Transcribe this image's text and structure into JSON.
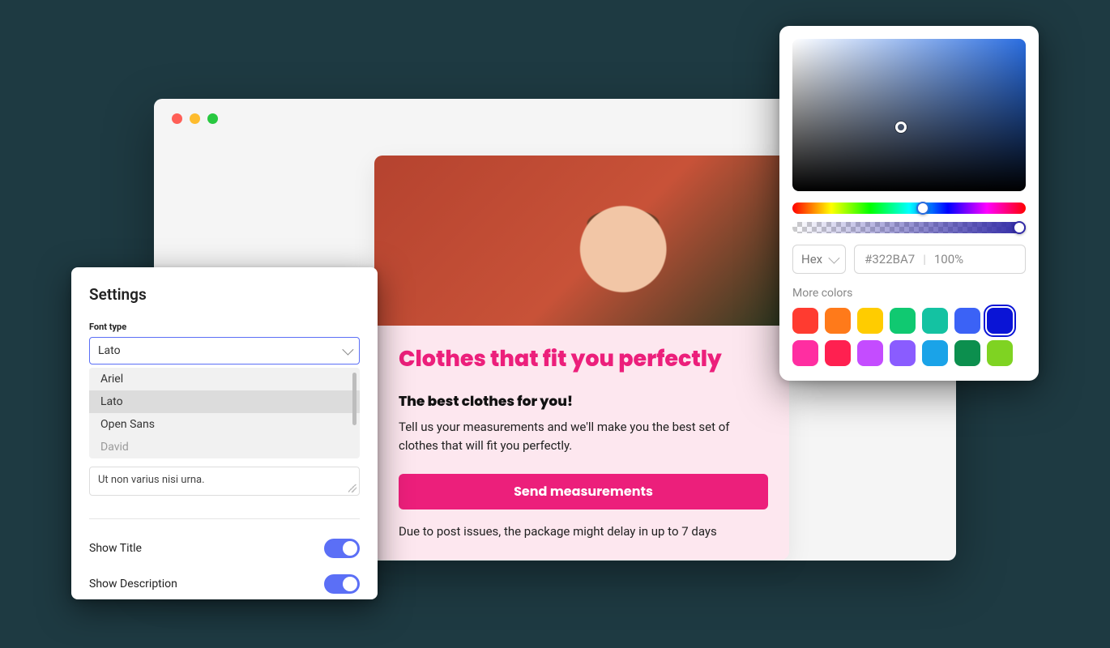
{
  "browser": {
    "card": {
      "title": "Clothes that fit you perfectly",
      "subtitle": "The best clothes for you!",
      "description": "Tell us your measurements and we'll make you the best set of clothes that will fit you perfectly.",
      "button_label": "Send measurements",
      "note": "Due to post issues, the package might delay in up to 7 days"
    }
  },
  "settings": {
    "title": "Settings",
    "font_type_label": "Font type",
    "font_selected": "Lato",
    "font_options": [
      "Ariel",
      "Lato",
      "Open Sans",
      "David"
    ],
    "text_sample": "Ut non varius nisi urna.",
    "show_title_label": "Show Title",
    "show_title_on": true,
    "show_description_label": "Show Description",
    "show_description_on": true
  },
  "picker": {
    "format": "Hex",
    "value": "#322BA7",
    "opacity": "100%",
    "more_colors_label": "More colors",
    "swatches": [
      {
        "color": "#ff3b30",
        "selected": false
      },
      {
        "color": "#ff7a1a",
        "selected": false
      },
      {
        "color": "#ffcc00",
        "selected": false
      },
      {
        "color": "#10c971",
        "selected": false
      },
      {
        "color": "#14c2a2",
        "selected": false
      },
      {
        "color": "#3b62f6",
        "selected": false
      },
      {
        "color": "#0a14d6",
        "selected": true
      },
      {
        "color": "#ff2ea1",
        "selected": false
      },
      {
        "color": "#ff2050",
        "selected": false
      },
      {
        "color": "#c44cff",
        "selected": false
      },
      {
        "color": "#8a5cff",
        "selected": false
      },
      {
        "color": "#1aa3e8",
        "selected": false
      },
      {
        "color": "#0c8f4e",
        "selected": false
      },
      {
        "color": "#7fd322",
        "selected": false
      }
    ]
  }
}
